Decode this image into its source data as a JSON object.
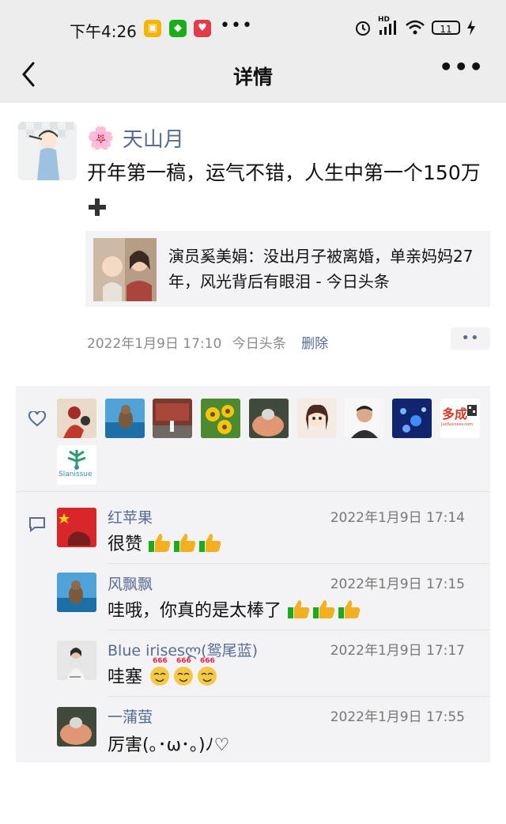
{
  "status_bar": {
    "time": "下午4:26",
    "battery": "11",
    "network": "HD",
    "icons": [
      "clock-alarm-icon",
      "signal-icon",
      "wifi-icon",
      "battery-icon",
      "charging-icon"
    ]
  },
  "nav": {
    "title": "详情",
    "back_icon": "chevron-left-icon",
    "more_icon": "more-dots-icon"
  },
  "post": {
    "author": "天山月",
    "author_flower": "🌸",
    "content": "开年第一稿，运气不错，人生中第一个150万",
    "link_title": "演员奚美娟：没出月子被离婚，单亲妈妈27年，风光背后有眼泪 - 今日头条",
    "timestamp": "2022年1月9日 17:10",
    "source": "今日头条",
    "delete_label": "删除",
    "more_label": "••"
  },
  "likes": {
    "icon": "heart-outline-icon",
    "avatar_labels": [
      "多成",
      "JuoSuccess.com",
      "Slanissue"
    ]
  },
  "comments": [
    {
      "name": "红苹果",
      "time": "2022年1月9日 17:14",
      "text": "很赞",
      "emoji": "thumbs-up",
      "emoji_count": 3
    },
    {
      "name": "风飘飘",
      "time": "2022年1月9日 17:15",
      "text": "哇哦，你真的是太棒了",
      "emoji": "thumbs-up",
      "emoji_count": 3
    },
    {
      "name": "Blue  irisesლ(鸳尾蓝)",
      "time": "2022年1月9日 17:17",
      "text": "哇塞",
      "emoji": "666-face",
      "emoji_count": 3,
      "emoji_caption": "666"
    },
    {
      "name": "一蒲萤",
      "time": "2022年1月9日 17:55",
      "text": "厉害(｡･ω･｡)ﾉ♡"
    }
  ],
  "colors": {
    "link_blue": "#576b95",
    "panel_bg": "#f3f3f5",
    "top_bg": "#ededed"
  }
}
